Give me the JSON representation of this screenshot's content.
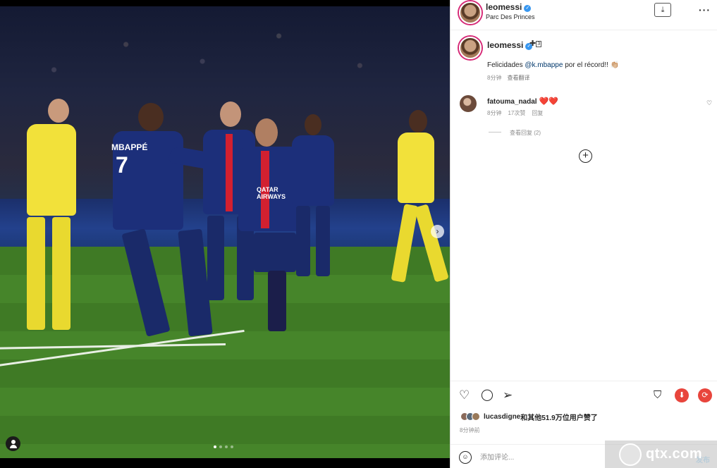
{
  "post": {
    "username": "leomessi",
    "location": "Parc Des Princes",
    "collab_count": "3",
    "caption_prefix": "Felicidades ",
    "caption_mention": "@k.mbappe",
    "caption_suffix": " por el récord!! 👏🏼",
    "caption_time": "8分钟",
    "caption_translate": "查看翻译"
  },
  "media": {
    "jersey_name": "MBAPPÉ",
    "jersey_number": "7",
    "sponsor": "QATAR AIRWAYS",
    "carousel_total": 4,
    "carousel_active": 1
  },
  "comments": [
    {
      "username": "fatouma_nadal",
      "text": "❤️❤️",
      "time": "8分钟",
      "likes": "17次赞",
      "reply": "回复",
      "view_replies": "查看回复 (2)"
    }
  ],
  "actions": {
    "like_icon": "heart-icon",
    "comment_icon": "comment-icon",
    "share_icon": "send-icon",
    "save_icon": "bookmark-icon",
    "download_icon": "download-icon",
    "refresh_icon": "refresh-icon"
  },
  "likes_summary": {
    "liked_by": "lucasdigne",
    "others": "和其他51.9万位用户赞了"
  },
  "post_time": "8分钟前",
  "comment_box": {
    "placeholder": "添加评论...",
    "post_label": "发布"
  },
  "watermark": {
    "text": "qtx.com"
  },
  "colors": {
    "verified": "#3897f0",
    "heart": "#e0245e",
    "ext_red": "#e8453c",
    "mention": "#00376b"
  }
}
